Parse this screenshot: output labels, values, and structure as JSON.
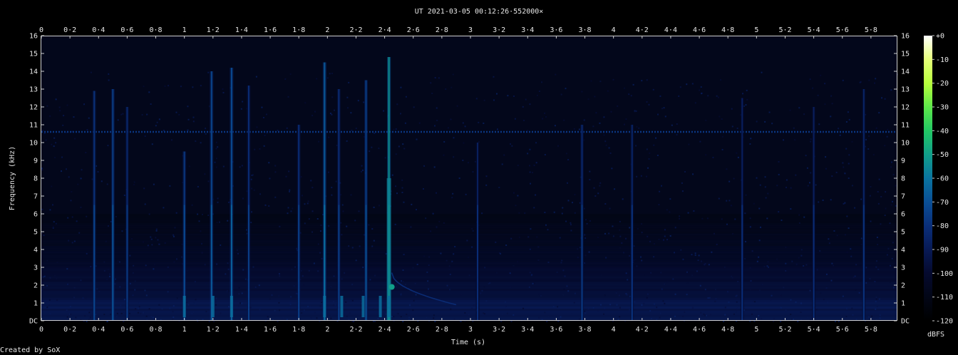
{
  "chart_data": {
    "type": "heatmap",
    "title": "UT 2021-03-05 00:12:26·552000×",
    "xlabel": "Time (s)",
    "ylabel": "Frequency (kHz)",
    "xlim": [
      0,
      5.98
    ],
    "ylim": [
      0,
      16
    ],
    "x_ticks": [
      "0",
      "0·2",
      "0·4",
      "0·6",
      "0·8",
      "1",
      "1·2",
      "1·4",
      "1·6",
      "1·8",
      "2",
      "2·2",
      "2·4",
      "2·6",
      "2·8",
      "3",
      "3·2",
      "3·4",
      "3·6",
      "3·8",
      "4",
      "4·2",
      "4·4",
      "4·6",
      "4·8",
      "5",
      "5·2",
      "5·4",
      "5·6",
      "5·8"
    ],
    "y_ticks": [
      "DC",
      "1",
      "2",
      "3",
      "4",
      "5",
      "6",
      "7",
      "8",
      "9",
      "10",
      "11",
      "12",
      "13",
      "14",
      "15",
      "16"
    ],
    "colorbar": {
      "label": "dBFS",
      "range": [
        -120,
        0
      ],
      "ticks": [
        "+0",
        "-10",
        "-20",
        "-30",
        "-40",
        "-50",
        "-60",
        "-70",
        "-80",
        "-90",
        "-100",
        "-110",
        "-120"
      ],
      "colors": [
        "#ffffff",
        "#e6ff7a",
        "#b8ff3c",
        "#5ee84a",
        "#22c864",
        "#119f8a",
        "#0a74a0",
        "#0a4f96",
        "#0a2f7a",
        "#081a55",
        "#050a2e",
        "#020616",
        "#000000"
      ]
    },
    "background_dbfs": -108,
    "hum_line_khz": 10.6,
    "events": [
      {
        "t": 0.37,
        "f_top": 12.9,
        "level": -78
      },
      {
        "t": 0.5,
        "f_top": 13.0,
        "level": -74
      },
      {
        "t": 0.6,
        "f_top": 12.0,
        "level": -82
      },
      {
        "t": 1.0,
        "f_top": 9.5,
        "level": -76
      },
      {
        "t": 1.19,
        "f_top": 14.0,
        "level": -72
      },
      {
        "t": 1.33,
        "f_top": 14.2,
        "level": -70
      },
      {
        "t": 1.45,
        "f_top": 13.2,
        "level": -80
      },
      {
        "t": 1.8,
        "f_top": 11.0,
        "level": -80
      },
      {
        "t": 1.98,
        "f_top": 14.5,
        "level": -66
      },
      {
        "t": 2.08,
        "f_top": 13.0,
        "level": -80
      },
      {
        "t": 2.27,
        "f_top": 13.5,
        "level": -74
      },
      {
        "t": 2.43,
        "f_top": 14.8,
        "level": -52
      },
      {
        "t": 3.05,
        "f_top": 10.0,
        "level": -86
      },
      {
        "t": 3.78,
        "f_top": 11.0,
        "level": -82
      },
      {
        "t": 4.13,
        "f_top": 11.0,
        "level": -84
      },
      {
        "t": 4.9,
        "f_top": 12.5,
        "level": -86
      },
      {
        "t": 5.4,
        "f_top": 12.0,
        "level": -86
      },
      {
        "t": 5.75,
        "f_top": 13.0,
        "level": -84
      }
    ],
    "sweep": {
      "t_start": 2.45,
      "t_end": 2.9,
      "f_start_khz": 2.7,
      "f_end_khz": 0.9
    },
    "low_band_bursts_s": [
      1.0,
      1.2,
      1.33,
      1.98,
      2.1,
      2.25,
      2.37,
      2.43
    ]
  },
  "footer": {
    "credit": "Created by SoX"
  }
}
